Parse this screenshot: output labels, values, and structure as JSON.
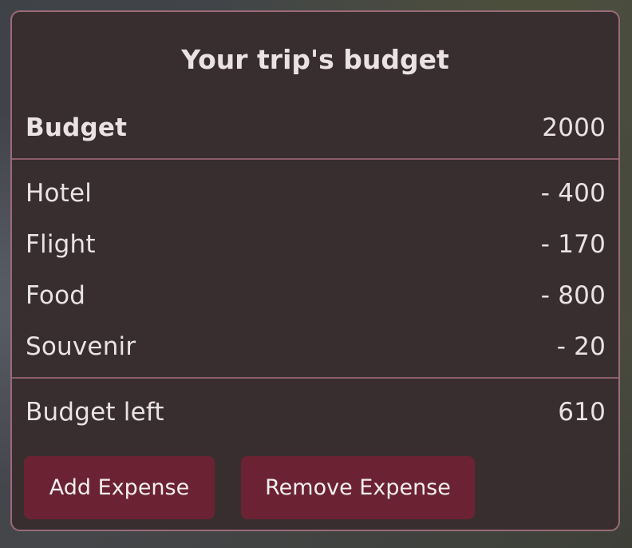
{
  "card": {
    "title": "Your trip's budget",
    "budget": {
      "label": "Budget",
      "value": "2000"
    },
    "expenses": [
      {
        "label": "Hotel",
        "value": "- 400"
      },
      {
        "label": "Flight",
        "value": "- 170"
      },
      {
        "label": "Food",
        "value": "- 800"
      },
      {
        "label": "Souvenir",
        "value": "- 20"
      }
    ],
    "remaining": {
      "label": "Budget left",
      "value": "610"
    }
  },
  "actions": {
    "add_label": "Add Expense",
    "remove_label": "Remove Expense"
  },
  "colors": {
    "card_background": "#382e30",
    "card_border": "#9a6a78",
    "button_background": "#6b2333",
    "text": "#e9e3e4"
  }
}
